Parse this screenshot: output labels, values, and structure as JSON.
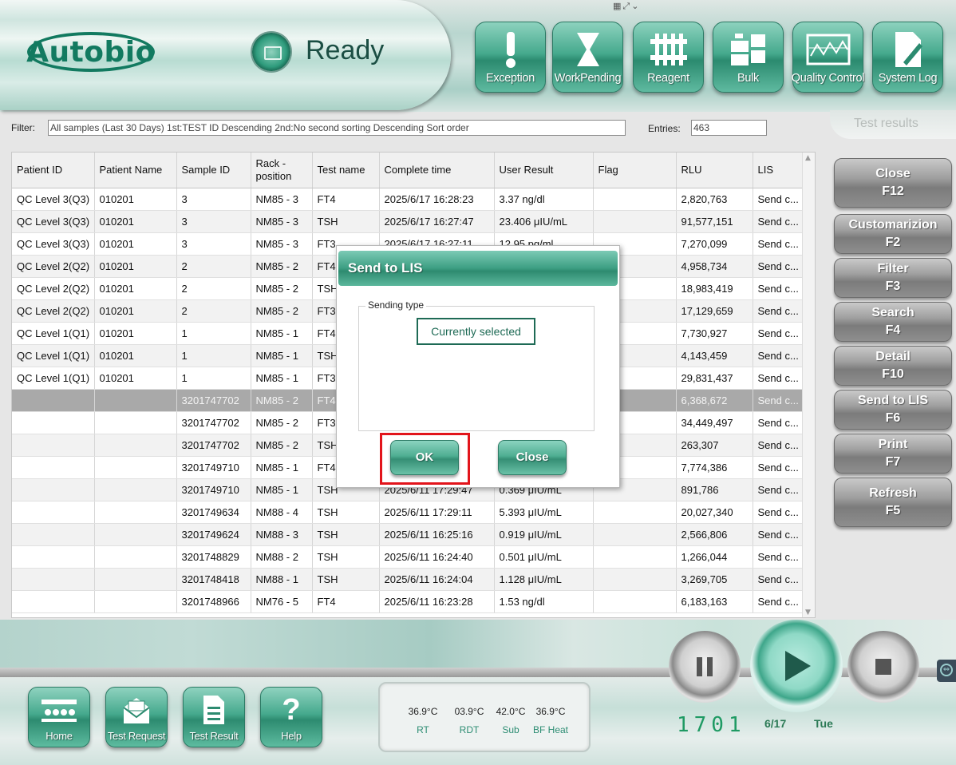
{
  "brand": {
    "logo_text": "Autobio"
  },
  "status": {
    "text": "Ready"
  },
  "toolbar": [
    {
      "label": "Exception",
      "icon": "exclamation-icon"
    },
    {
      "label": "WorkPending",
      "icon": "hourglass-icon"
    },
    {
      "label": "Reagent",
      "icon": "reagent-rack-icon"
    },
    {
      "label": "Bulk",
      "icon": "bulk-bottles-icon"
    },
    {
      "label": "Quality Control",
      "icon": "qc-chart-icon"
    },
    {
      "label": "System Log",
      "icon": "log-document-icon"
    }
  ],
  "filter": {
    "label": "Filter:",
    "value": "All samples (Last 30 Days)   1st:TEST ID Descending 2nd:No second sorting Descending Sort order",
    "entries_label": "Entries:",
    "entries_value": "463"
  },
  "page_tab": "Test results",
  "table": {
    "columns": [
      "Patient ID",
      "Patient Name",
      "Sample ID",
      "Rack - position",
      "Test name",
      "Complete time",
      "User Result",
      "Flag",
      "RLU",
      "LIS"
    ],
    "rows": [
      [
        "QC Level 3(Q3)",
        "010201",
        "3",
        "NM85 - 3",
        "FT4",
        "2025/6/17 16:28:23",
        "3.37 ng/dl",
        "",
        "2,820,763",
        "Send c..."
      ],
      [
        "QC Level 3(Q3)",
        "010201",
        "3",
        "NM85 - 3",
        "TSH",
        "2025/6/17 16:27:47",
        "23.406 μIU/mL",
        "",
        "91,577,151",
        "Send c..."
      ],
      [
        "QC Level 3(Q3)",
        "010201",
        "3",
        "NM85 - 3",
        "FT3",
        "2025/6/17 16:27:11",
        "12.95 pg/ml",
        "",
        "7,270,099",
        "Send c..."
      ],
      [
        "QC Level 2(Q2)",
        "010201",
        "2",
        "NM85 - 2",
        "FT4",
        "",
        "",
        "",
        "4,958,734",
        "Send c..."
      ],
      [
        "QC Level 2(Q2)",
        "010201",
        "2",
        "NM85 - 2",
        "TSH",
        "",
        "",
        "",
        "18,983,419",
        "Send c..."
      ],
      [
        "QC Level 2(Q2)",
        "010201",
        "2",
        "NM85 - 2",
        "FT3",
        "",
        "",
        "",
        "17,129,659",
        "Send c..."
      ],
      [
        "QC Level 1(Q1)",
        "010201",
        "1",
        "NM85 - 1",
        "FT4",
        "",
        "",
        "",
        "7,730,927",
        "Send c..."
      ],
      [
        "QC Level 1(Q1)",
        "010201",
        "1",
        "NM85 - 1",
        "TSH",
        "",
        "",
        "",
        "4,143,459",
        "Send c..."
      ],
      [
        "QC Level 1(Q1)",
        "010201",
        "1",
        "NM85 - 1",
        "FT3",
        "",
        "",
        "",
        "29,831,437",
        "Send c..."
      ],
      [
        "",
        "",
        "3201747702",
        "NM85 - 2",
        "FT4",
        "",
        "",
        "",
        "6,368,672",
        "Send c..."
      ],
      [
        "",
        "",
        "3201747702",
        "NM85 - 2",
        "FT3",
        "",
        "",
        "",
        "34,449,497",
        "Send c..."
      ],
      [
        "",
        "",
        "3201747702",
        "NM85 - 2",
        "TSH",
        "",
        "",
        "",
        "263,307",
        "Send c..."
      ],
      [
        "",
        "",
        "3201749710",
        "NM85 - 1",
        "FT4",
        "",
        "",
        "",
        "7,774,386",
        "Send c..."
      ],
      [
        "",
        "",
        "3201749710",
        "NM85 - 1",
        "TSH",
        "2025/6/11 17:29:47",
        "0.369 μIU/mL",
        "",
        "891,786",
        "Send c..."
      ],
      [
        "",
        "",
        "3201749634",
        "NM88 - 4",
        "TSH",
        "2025/6/11 17:29:11",
        "5.393 μIU/mL",
        "",
        "20,027,340",
        "Send c..."
      ],
      [
        "",
        "",
        "3201749624",
        "NM88 - 3",
        "TSH",
        "2025/6/11 16:25:16",
        "0.919 μIU/mL",
        "",
        "2,566,806",
        "Send c..."
      ],
      [
        "",
        "",
        "3201748829",
        "NM88 - 2",
        "TSH",
        "2025/6/11 16:24:40",
        "0.501 μIU/mL",
        "",
        "1,266,044",
        "Send c..."
      ],
      [
        "",
        "",
        "3201748418",
        "NM88 - 1",
        "TSH",
        "2025/6/11 16:24:04",
        "1.128 μIU/mL",
        "",
        "3,269,705",
        "Send c..."
      ],
      [
        "",
        "",
        "3201748966",
        "NM76 - 5",
        "FT4",
        "2025/6/11 16:23:28",
        "1.53 ng/dl",
        "",
        "6,183,163",
        "Send c..."
      ]
    ],
    "selected_row": 9
  },
  "side_buttons": [
    {
      "label": "Close",
      "key": "F12"
    },
    {
      "label": "Customarizion",
      "key": "F2"
    },
    {
      "label": "Filter",
      "key": "F3"
    },
    {
      "label": "Search",
      "key": "F4"
    },
    {
      "label": "Detail",
      "key": "F10"
    },
    {
      "label": "Send to LIS",
      "key": "F6"
    },
    {
      "label": "Print",
      "key": "F7"
    },
    {
      "label": "Refresh",
      "key": "F5"
    }
  ],
  "nav": [
    {
      "label": "Home",
      "icon": "home-icon"
    },
    {
      "label": "Test Request",
      "icon": "envelope-icon"
    },
    {
      "label": "Test Result",
      "icon": "document-icon"
    },
    {
      "label": "Help",
      "icon": "help-icon"
    }
  ],
  "temps": [
    {
      "value": "36.9°C",
      "name": "RT"
    },
    {
      "value": "03.9°C",
      "name": "RDT"
    },
    {
      "value": "42.0°C",
      "name": "Sub"
    },
    {
      "value": "36.9°C",
      "name": "BF Heat"
    }
  ],
  "clock": {
    "time": "1701",
    "date": "6/17",
    "day": "Tue"
  },
  "dialog": {
    "title": "Send to LIS",
    "group_label": "Sending type",
    "option": "Currently selected",
    "ok": "OK",
    "close": "Close"
  }
}
